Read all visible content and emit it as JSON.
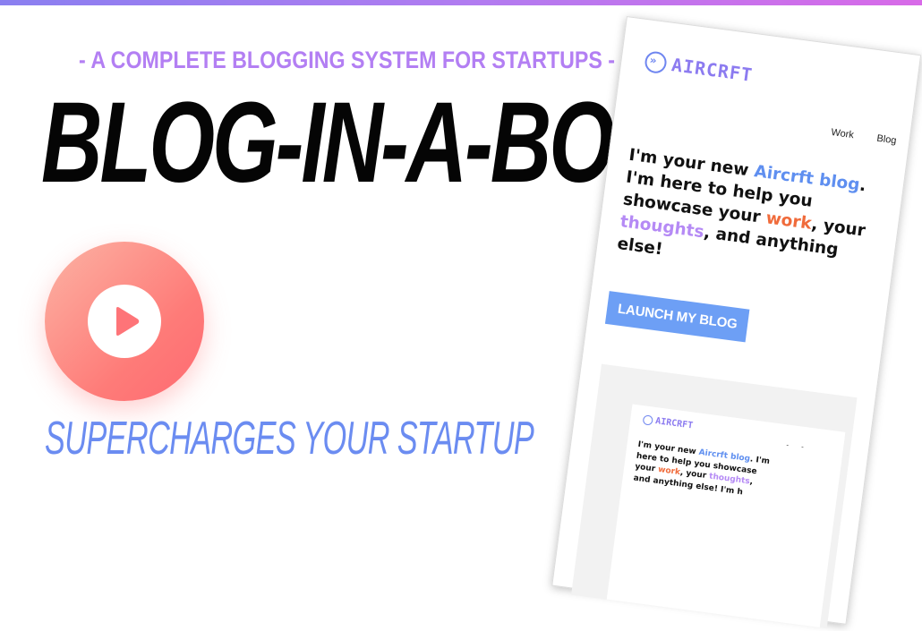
{
  "hero": {
    "tagline": "- A COMPLETE BLOGGING SYSTEM FOR STARTUPS -",
    "headline": "BLOG-IN-A-BOX",
    "subtitle": "SUPERCHARGES YOUR STARTUP"
  },
  "play_button": {
    "icon": "play-icon"
  },
  "mockup": {
    "logo_text": "AIRCRFT",
    "nav": [
      "Work",
      "Blog"
    ],
    "hero": {
      "part1": "I'm your new ",
      "brand": "Aircrft blog",
      "part2": ". I'm here to help you showcase your ",
      "work": "work",
      "part3": ", your ",
      "thoughts": "thoughts",
      "part4": ", and anything else!"
    },
    "cta_label": "LAUNCH MY BLOG",
    "preview": {
      "logo_text": "AIRCRFT",
      "hero": {
        "part1": "I'm your new ",
        "brand": "Aircrft blog",
        "part2": ". I'm here to help you showcase your ",
        "work": "work",
        "part3": ", your ",
        "thoughts": "thoughts",
        "part4": ", and anything else! I'm h"
      }
    }
  },
  "colors": {
    "accent_purple": "#b37ff3",
    "accent_blue": "#6b8cf1",
    "play_gradient_start": "#fcb3a4",
    "play_gradient_end": "#ff6a72",
    "work_orange": "#f06b3b"
  }
}
